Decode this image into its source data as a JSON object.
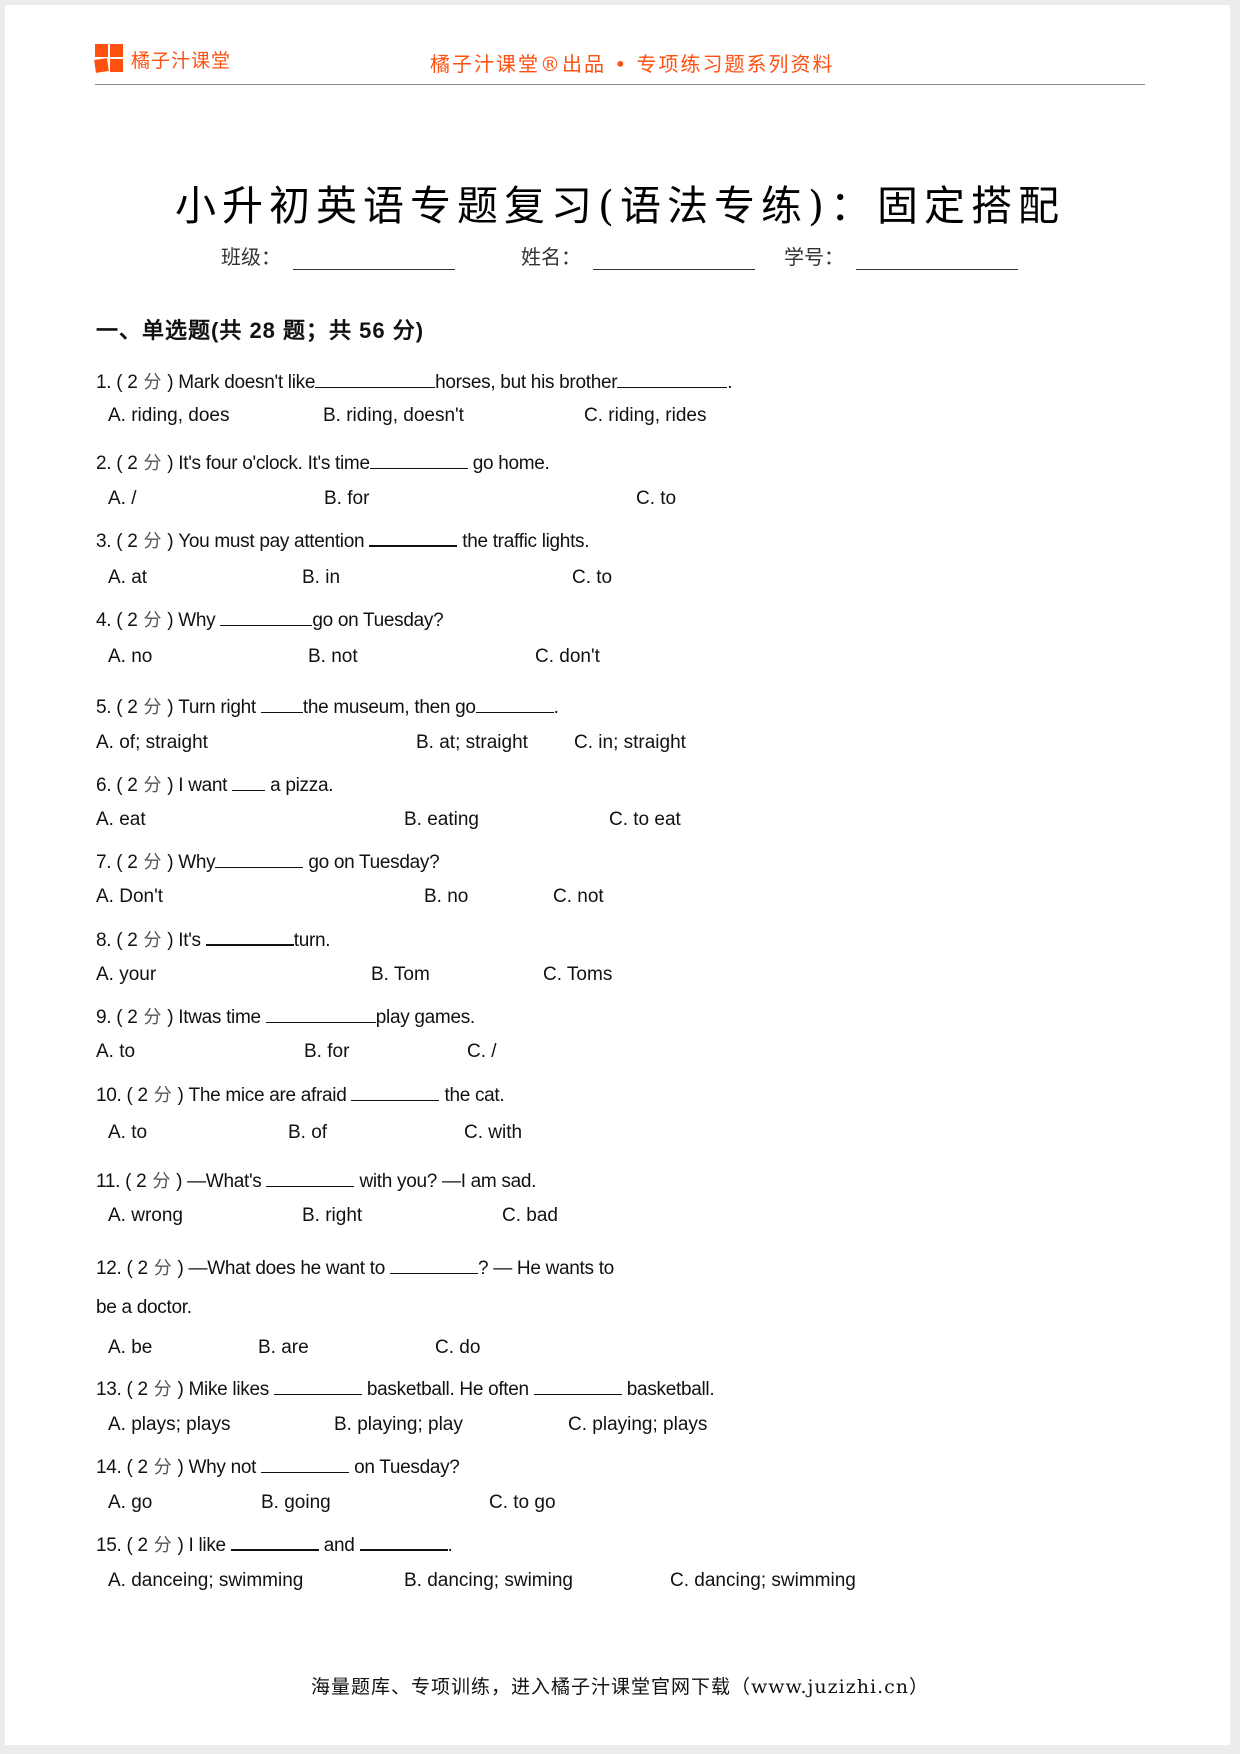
{
  "header": {
    "logo_text": "橘子汁课堂",
    "slogan": "橘子汁课堂®出品 • 专项练习题系列资料",
    "brand_color": "#ff5010"
  },
  "title": "小升初英语专题复习(语法专练)：固定搭配",
  "info_fields": {
    "class_label": "班级：",
    "name_label": "姓名：",
    "id_label": "学号："
  },
  "section_heading": "一、单选题(共 28 题；共 56 分)",
  "score_unit": "分",
  "questions": [
    {
      "num": "1.",
      "score": "2",
      "parts": [
        "Mark doesn't like",
        "horses, but his brother",
        "."
      ],
      "options": [
        "A. riding, does",
        "B. riding, doesn't",
        "C. riding, rides"
      ]
    },
    {
      "num": "2.",
      "score": "2",
      "parts": [
        "It's four o'clock. It's time",
        " go home."
      ],
      "options": [
        "A. /",
        "B. for",
        "C. to"
      ]
    },
    {
      "num": "3.",
      "score": "2",
      "parts": [
        "You must pay attention ",
        " the traffic lights."
      ],
      "options": [
        "A. at",
        "B. in",
        "C. to"
      ]
    },
    {
      "num": "4.",
      "score": "2",
      "parts": [
        "Why ",
        "go on Tuesday?"
      ],
      "options": [
        "A. no",
        "B. not",
        "C. don't"
      ]
    },
    {
      "num": "5.",
      "score": "2",
      "parts": [
        "Turn right ",
        "the museum, then go",
        "."
      ],
      "options": [
        "A. of; straight",
        "B. at; straight",
        "C. in; straight"
      ]
    },
    {
      "num": "6.",
      "score": "2",
      "parts": [
        "I want ",
        " a pizza."
      ],
      "options": [
        "A. eat",
        "B. eating",
        "C. to eat"
      ]
    },
    {
      "num": "7.",
      "score": "2",
      "parts": [
        "Why",
        " go on Tuesday?"
      ],
      "options": [
        "A. Don't",
        "B. no",
        "C. not"
      ]
    },
    {
      "num": "8.",
      "score": "2",
      "parts": [
        "It's ",
        "turn."
      ],
      "options": [
        "A. your",
        "B. Tom",
        "C. Toms"
      ]
    },
    {
      "num": "9.",
      "score": "2",
      "parts": [
        "Itwas time ",
        "play games."
      ],
      "options": [
        "A. to",
        "B. for",
        "C. /"
      ]
    },
    {
      "num": "10.",
      "score": "2",
      "parts": [
        "The mice are afraid ",
        " the cat."
      ],
      "options": [
        "A. to",
        "B. of",
        "C. with"
      ]
    },
    {
      "num": "11.",
      "score": "2",
      "parts": [
        "—What's ",
        " with you? —I am sad."
      ],
      "options": [
        "A. wrong",
        "B. right",
        "C. bad"
      ]
    },
    {
      "num": "12.",
      "score": "2",
      "parts": [
        "—What does he want to ",
        "? — He wants to"
      ],
      "continuation": "be a doctor.",
      "options": [
        "A. be",
        "B. are",
        "C. do"
      ]
    },
    {
      "num": "13.",
      "score": "2",
      "parts": [
        "Mike likes ",
        " basketball. He often ",
        " basketball."
      ],
      "options": [
        "A. plays; plays",
        "B. playing; play",
        "C. playing; plays"
      ]
    },
    {
      "num": "14.",
      "score": "2",
      "parts": [
        "Why not ",
        " on Tuesday?"
      ],
      "options": [
        "A. go",
        "B. going",
        "C. to go"
      ]
    },
    {
      "num": "15.",
      "score": "2",
      "parts": [
        "I like ",
        " and ",
        "."
      ],
      "options": [
        "A. danceing; swimming",
        "B. dancing; swiming",
        "C. dancing; swimming"
      ]
    }
  ],
  "footer": "海量题库、专项训练，进入橘子汁课堂官网下载（www.juzizhi.cn）"
}
